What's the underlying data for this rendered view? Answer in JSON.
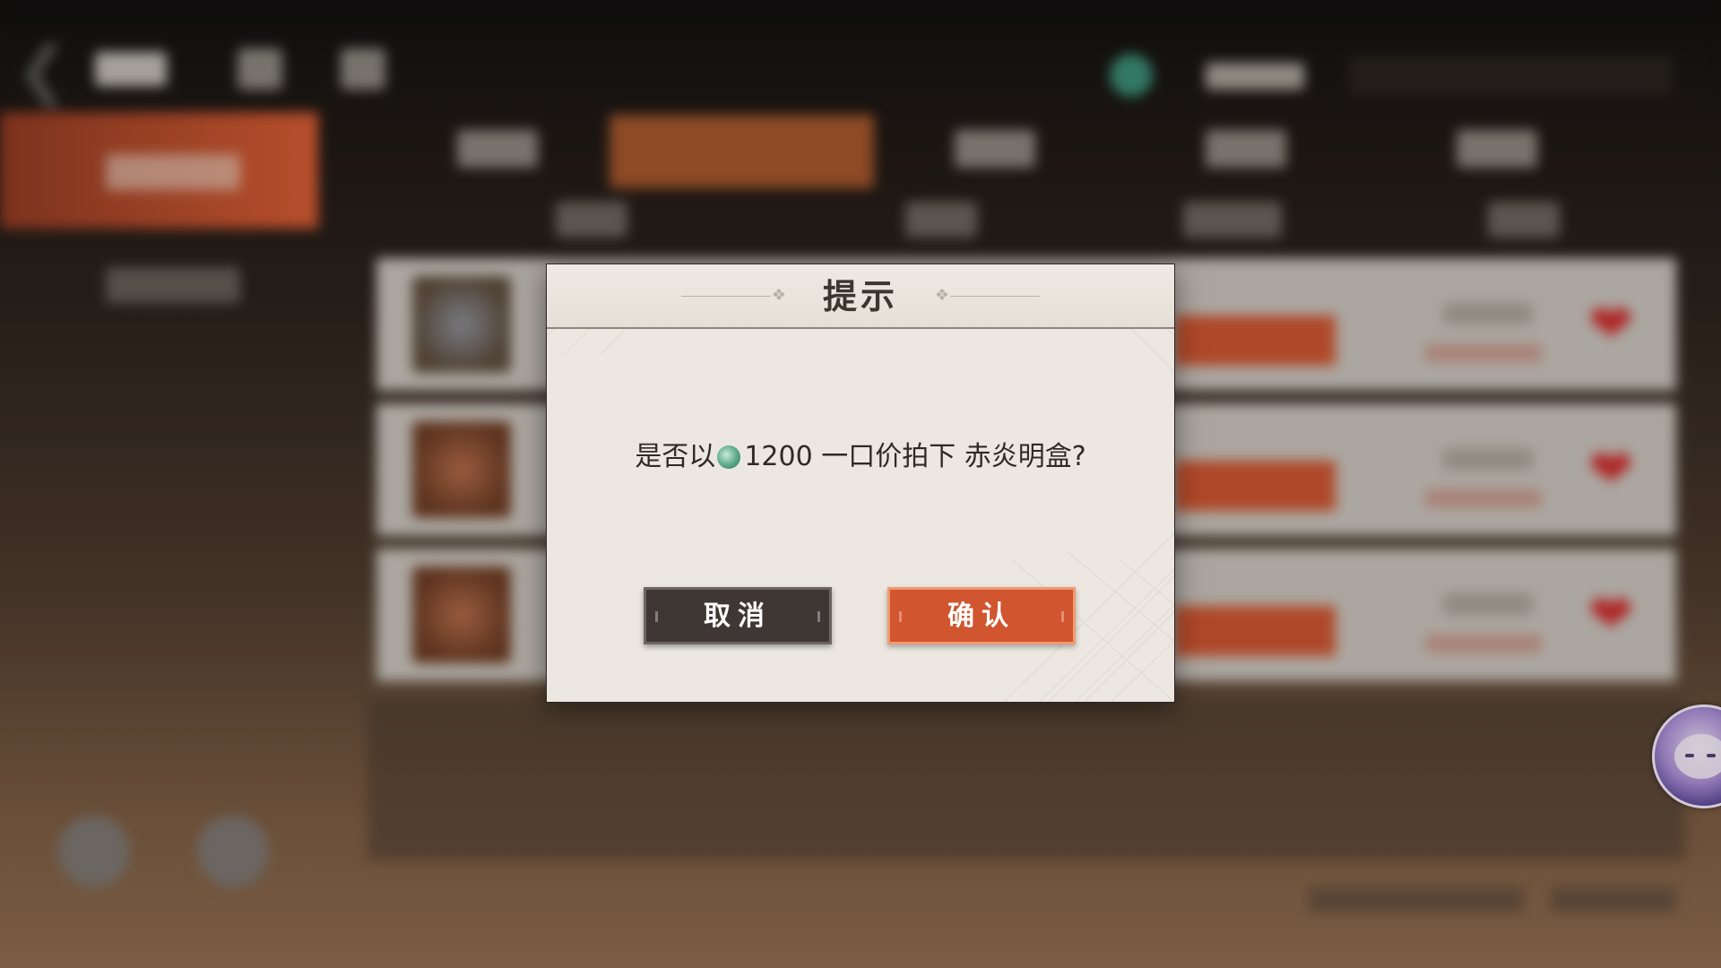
{
  "dialog": {
    "title": "提示",
    "message_prefix": "是否以",
    "price": "1200",
    "message_suffix": "一口价拍下 赤炎明盒?",
    "currency_icon": "jade-coin-icon",
    "cancel_label": "取消",
    "confirm_label": "确认"
  },
  "colors": {
    "confirm": "#d1552f",
    "cancel": "#3f3734",
    "dialog_bg": "#ece8e1",
    "heart": "#c82a2a"
  },
  "background": {
    "item_rows": 3,
    "icons": [
      "back-arrow-icon",
      "home-icon",
      "bag-icon",
      "jade-coin-icon",
      "search-icon",
      "heart-icon",
      "mascot-icon"
    ]
  }
}
